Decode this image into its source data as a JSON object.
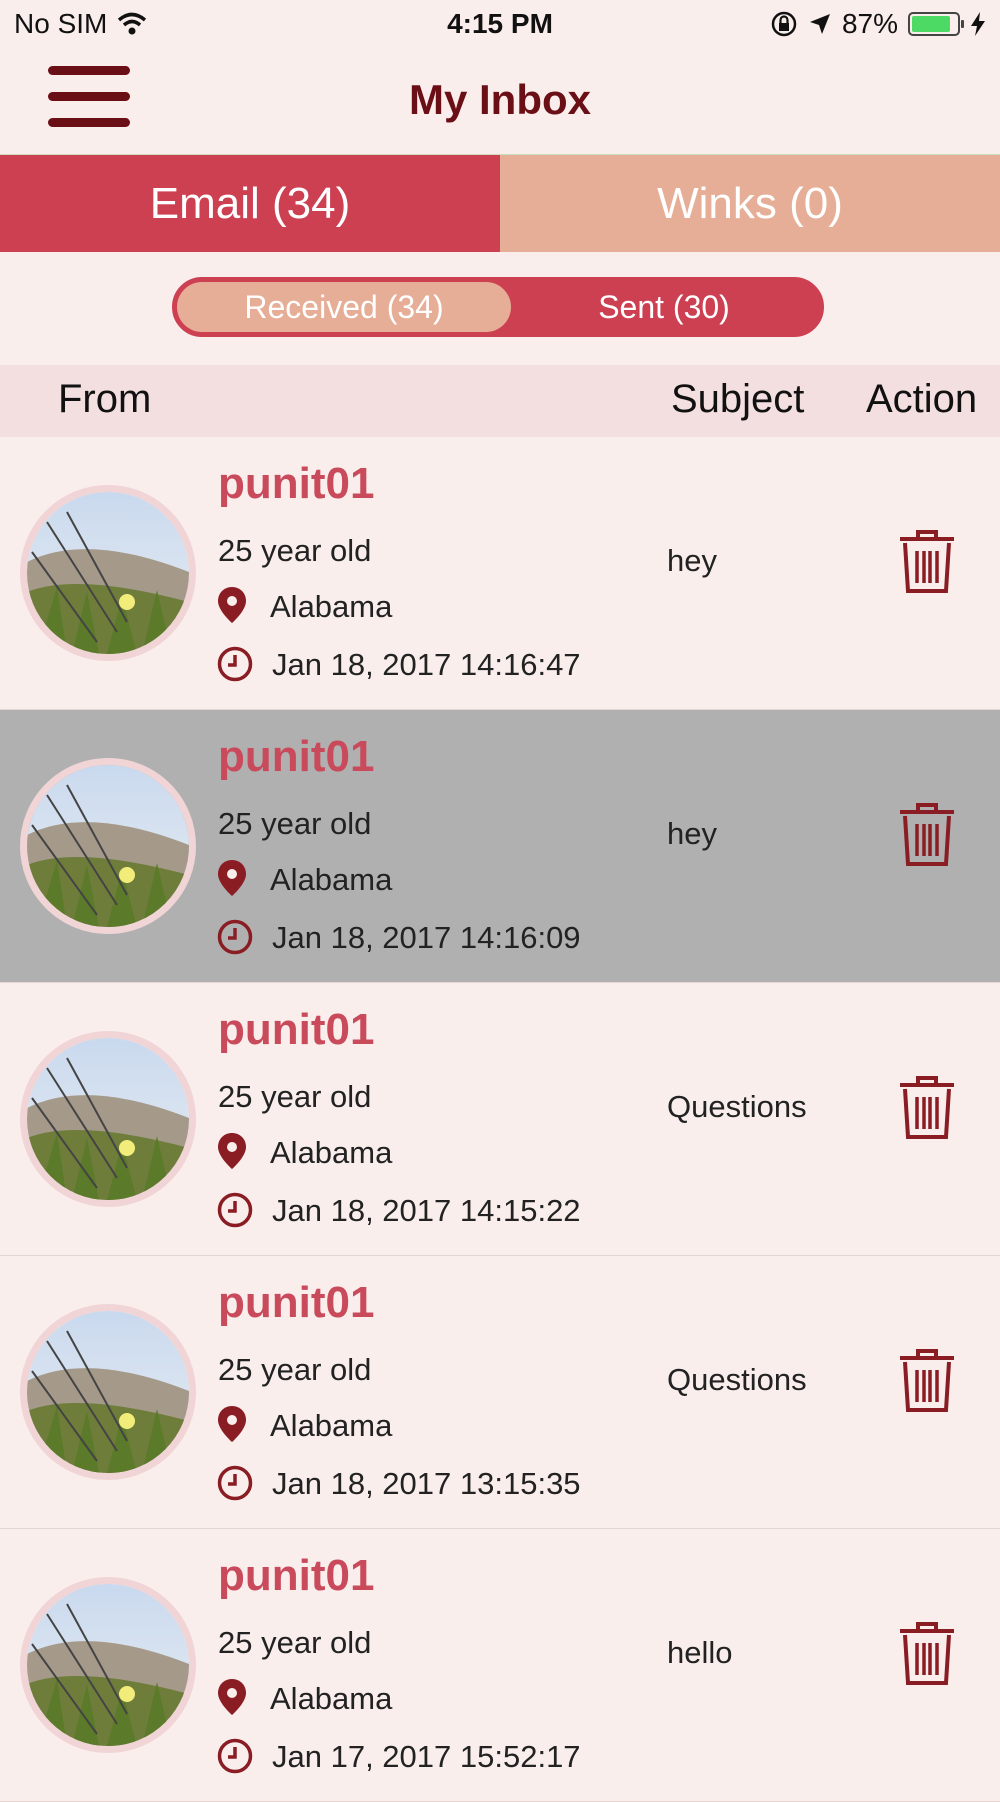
{
  "status_bar": {
    "carrier": "No SIM",
    "time": "4:15 PM",
    "battery_percent": "87%",
    "battery_level": 0.87,
    "icons": [
      "wifi-icon",
      "orientation-lock-icon",
      "location-arrow-icon",
      "battery-icon",
      "charging-bolt-icon"
    ]
  },
  "navbar": {
    "title": "My Inbox",
    "menu_icon": "hamburger-menu-icon"
  },
  "tabs": [
    {
      "label": "Email (34)",
      "active": true
    },
    {
      "label": "Winks (0)",
      "active": false
    }
  ],
  "segment": {
    "received": "Received (34)",
    "sent": "Sent (30)",
    "selected": "received"
  },
  "columns": {
    "from": "From",
    "subject": "Subject",
    "action": "Action"
  },
  "messages": [
    {
      "username": "punit01",
      "age": "25 year old",
      "location": "Alabama",
      "date": "Jan 18, 2017 14:16:47",
      "subject": "hey"
    },
    {
      "username": "punit01",
      "age": "25 year old",
      "location": "Alabama",
      "date": "Jan 18, 2017 14:16:09",
      "subject": "hey"
    },
    {
      "username": "punit01",
      "age": "25 year old",
      "location": "Alabama",
      "date": "Jan 18, 2017 14:15:22",
      "subject": "Questions"
    },
    {
      "username": "punit01",
      "age": "25 year old",
      "location": "Alabama",
      "date": "Jan 18, 2017 13:15:35",
      "subject": "Questions"
    },
    {
      "username": "punit01",
      "age": "25 year old",
      "location": "Alabama",
      "date": "Jan 17, 2017 15:52:17",
      "subject": "hello"
    }
  ],
  "colors": {
    "accent_dark": "#6b0f16",
    "tab_active": "#cd4052",
    "tab_inactive": "#e6ae96",
    "username": "#c94a5b",
    "background": "#f9eeec"
  }
}
